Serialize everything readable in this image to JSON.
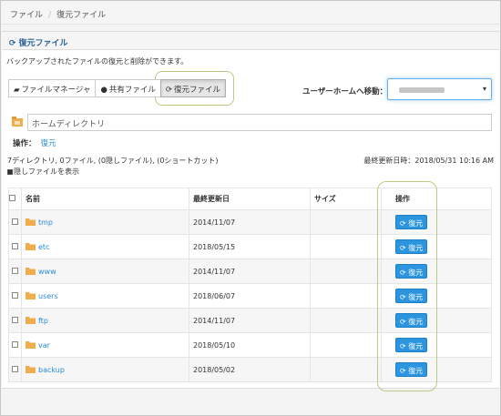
{
  "breadcrumb": {
    "home": "ファイル",
    "current": "復元ファイル"
  },
  "panel": {
    "title": "復元ファイル",
    "icon": "refresh-icon",
    "description": "バックアップされたファイルの復元と削除ができます。"
  },
  "tabs": [
    {
      "label": "ファイルマネージャ",
      "icon": "folder-open-icon",
      "active": false
    },
    {
      "label": "共有ファイル",
      "icon": "user-icon",
      "active": false
    },
    {
      "label": "復元ファイル",
      "icon": "refresh-icon",
      "active": true
    }
  ],
  "move": {
    "label": "ユーザーホームへ移動：",
    "selected_value": ""
  },
  "path": {
    "value": "ホームディレクトリ"
  },
  "operation": {
    "label": "操作：",
    "link": "復元"
  },
  "stats": "7ディレクトリ, 0ファイル, (0隠しファイル), (0ショートカット)",
  "last_updated": "最終更新日時：2018/05/31 10:16 AM",
  "show_hidden_label": "隠しファイルを表示",
  "table": {
    "headers": {
      "name": "名前",
      "date": "最終更新日",
      "size": "サイズ",
      "ops": "操作"
    },
    "rows": [
      {
        "name": "tmp",
        "date": "2014/11/07",
        "size": "",
        "action": "復元"
      },
      {
        "name": "etc",
        "date": "2018/05/15",
        "size": "",
        "action": "復元"
      },
      {
        "name": "www",
        "date": "2014/11/07",
        "size": "",
        "action": "復元"
      },
      {
        "name": "users",
        "date": "2018/06/07",
        "size": "",
        "action": "復元"
      },
      {
        "name": "ftp",
        "date": "2014/11/07",
        "size": "",
        "action": "復元"
      },
      {
        "name": "var",
        "date": "2018/05/10",
        "size": "",
        "action": "復元"
      },
      {
        "name": "backup",
        "date": "2018/05/02",
        "size": "",
        "action": "復元"
      }
    ]
  },
  "colors": {
    "accent": "#2b95e0",
    "link": "#2a8bd6",
    "folder": "#f0ad4e",
    "highlight": "#b7cc82"
  }
}
